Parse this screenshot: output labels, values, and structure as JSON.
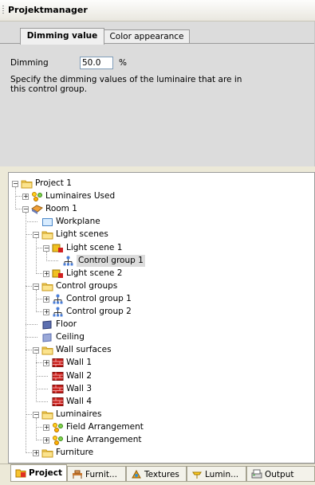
{
  "window": {
    "title": "Projektmanager"
  },
  "props": {
    "tabs": [
      {
        "label": "Dimming value",
        "active": true
      },
      {
        "label": "Color appearance",
        "active": false
      }
    ],
    "dimming": {
      "label": "Dimming",
      "value": "50.0",
      "unit": "%",
      "description": "Specify the dimming values of the luminaire that are in this control group."
    }
  },
  "tree": {
    "nodes": [
      {
        "label": "Project 1",
        "icon": "folder-icon",
        "expander": "minus"
      },
      {
        "label": "Luminaires Used",
        "icon": "luminaires-icon",
        "expander": "plus"
      },
      {
        "label": "Room 1",
        "icon": "room-icon",
        "expander": "minus"
      },
      {
        "label": "Workplane",
        "icon": "workplane-icon",
        "expander": ""
      },
      {
        "label": "Light scenes",
        "icon": "folder-icon",
        "expander": "minus"
      },
      {
        "label": "Light scene 1",
        "icon": "light-scene-icon",
        "expander": "minus"
      },
      {
        "label": "Control group 1",
        "icon": "control-group-icon",
        "expander": "",
        "selected": true
      },
      {
        "label": "Light scene 2",
        "icon": "light-scene-icon",
        "expander": "plus"
      },
      {
        "label": "Control groups",
        "icon": "folder-icon",
        "expander": "minus"
      },
      {
        "label": "Control group 1",
        "icon": "control-group-icon",
        "expander": "plus"
      },
      {
        "label": "Control group 2",
        "icon": "control-group-icon",
        "expander": "plus"
      },
      {
        "label": "Floor",
        "icon": "floor-icon",
        "expander": ""
      },
      {
        "label": "Ceiling",
        "icon": "ceiling-icon",
        "expander": ""
      },
      {
        "label": "Wall surfaces",
        "icon": "folder-icon",
        "expander": "minus"
      },
      {
        "label": "Wall 1",
        "icon": "wall-icon",
        "expander": "plus"
      },
      {
        "label": "Wall 2",
        "icon": "wall-icon",
        "expander": ""
      },
      {
        "label": "Wall 3",
        "icon": "wall-icon",
        "expander": ""
      },
      {
        "label": "Wall 4",
        "icon": "wall-icon",
        "expander": ""
      },
      {
        "label": "Luminaires",
        "icon": "folder-icon",
        "expander": "minus"
      },
      {
        "label": "Field Arrangement",
        "icon": "arrangement-icon",
        "expander": "plus"
      },
      {
        "label": "Line Arrangement",
        "icon": "arrangement-icon",
        "expander": "plus"
      },
      {
        "label": "Furniture",
        "icon": "folder-icon",
        "expander": "plus"
      }
    ]
  },
  "bottom_tabs": [
    {
      "label": "Project",
      "icon": "project-icon",
      "active": true
    },
    {
      "label": "Furnit...",
      "icon": "furniture-icon",
      "active": false
    },
    {
      "label": "Textures",
      "icon": "textures-icon",
      "active": false
    },
    {
      "label": "Lumin...",
      "icon": "luminaire-tab-icon",
      "active": false
    },
    {
      "label": "Output",
      "icon": "output-icon",
      "active": false
    }
  ]
}
